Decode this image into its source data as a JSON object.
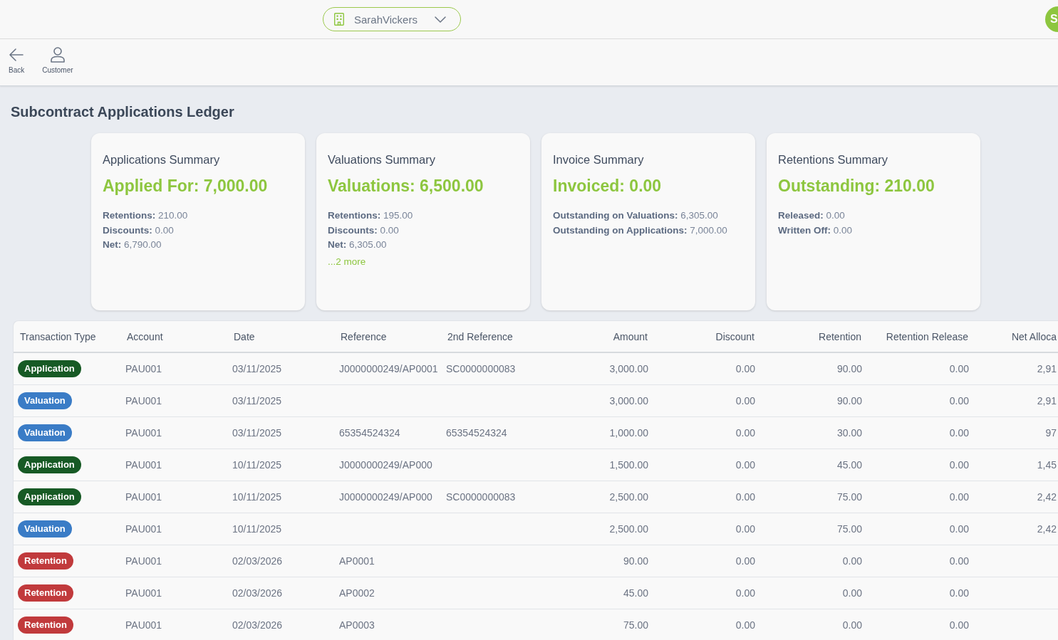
{
  "header": {
    "account_selector": {
      "value": "SarahVickers"
    },
    "avatar": {
      "initial": "S"
    }
  },
  "toolbar": {
    "buttons": [
      {
        "kind": "back",
        "label": "Back"
      },
      {
        "kind": "customer",
        "label": "Customer"
      }
    ]
  },
  "page_title": "Subcontract Applications Ledger",
  "summary_cards": [
    {
      "title": "Applications Summary",
      "headline": "Applied For: 7,000.00",
      "details": [
        "**Retentions:** 210.00",
        "**Discounts:** 0.00",
        "**Net:** 6,790.00"
      ]
    },
    {
      "title": "Valuations Summary",
      "headline": "Valuations: 6,500.00",
      "details": [
        "**Retentions:** 195.00",
        "**Discounts:** 0.00",
        "**Net:** 6,305.00"
      ],
      "more_link": "...2 more"
    },
    {
      "title": "Invoice Summary",
      "headline": "Invoiced: 0.00",
      "details": [
        "**Outstanding on Valuations:** 6,305.00",
        "**Outstanding on Applications:** 7,000.00"
      ]
    },
    {
      "title": "Retentions Summary",
      "headline": "Outstanding: 210.00",
      "details": [
        "**Released:** 0.00",
        "**Written Off:** 0.00"
      ]
    }
  ],
  "table": {
    "columns": [
      {
        "label": "Transaction Type",
        "kind": "badge"
      },
      {
        "label": "Account",
        "kind": "text"
      },
      {
        "label": "Date",
        "kind": "text"
      },
      {
        "label": "Reference",
        "kind": "text"
      },
      {
        "label": "2nd Reference",
        "kind": "text"
      },
      {
        "label": "Amount",
        "kind": "amount"
      },
      {
        "label": "Discount",
        "kind": "amount"
      },
      {
        "label": "Retention",
        "kind": "amount"
      },
      {
        "label": "Retention Release",
        "kind": "amount"
      },
      {
        "label": "Net Alloca",
        "kind": "amount"
      }
    ],
    "rows": [
      {
        "transaction_type": {
          "label": "Application",
          "color": "#175a25"
        },
        "account": "PAU001",
        "date": "03/11/2025",
        "reference": "J0000000249/AP0001",
        "second_reference": "SC0000000083",
        "amount": "3,000.00",
        "discount": "0.00",
        "retention": "90.00",
        "retention_release": "0.00",
        "column_10": "2,91"
      },
      {
        "transaction_type": {
          "label": "Valuation",
          "color": "#3a7cc6"
        },
        "account": "PAU001",
        "date": "03/11/2025",
        "amount": "3,000.00",
        "discount": "0.00",
        "retention": "90.00",
        "retention_release": "0.00",
        "column_10": "2,91"
      },
      {
        "transaction_type": {
          "label": "Valuation",
          "color": "#3a7cc6"
        },
        "account": "PAU001",
        "date": "03/11/2025",
        "reference": "65354524324",
        "second_reference": "65354524324",
        "amount": "1,000.00",
        "discount": "0.00",
        "retention": "30.00",
        "retention_release": "0.00",
        "column_10": "97"
      },
      {
        "transaction_type": {
          "label": "Application",
          "color": "#175a25"
        },
        "account": "PAU001",
        "date": "10/11/2025",
        "reference": "J0000000249/AP000",
        "amount": "1,500.00",
        "discount": "0.00",
        "retention": "45.00",
        "retention_release": "0.00",
        "column_10": "1,45"
      },
      {
        "transaction_type": {
          "label": "Application",
          "color": "#175a25"
        },
        "account": "PAU001",
        "date": "10/11/2025",
        "reference": "J0000000249/AP000",
        "second_reference": "SC0000000083",
        "amount": "2,500.00",
        "discount": "0.00",
        "retention": "75.00",
        "retention_release": "0.00",
        "column_10": "2,42"
      },
      {
        "transaction_type": {
          "label": "Valuation",
          "color": "#3a7cc6"
        },
        "account": "PAU001",
        "date": "10/11/2025",
        "amount": "2,500.00",
        "discount": "0.00",
        "retention": "75.00",
        "retention_release": "0.00",
        "column_10": "2,42"
      },
      {
        "transaction_type": {
          "label": "Retention",
          "color": "#c13a3c"
        },
        "account": "PAU001",
        "date": "02/03/2026",
        "reference": "AP0001",
        "amount": "90.00",
        "discount": "0.00",
        "retention": "0.00",
        "retention_release": "0.00"
      },
      {
        "transaction_type": {
          "label": "Retention",
          "color": "#c13a3c"
        },
        "account": "PAU001",
        "date": "02/03/2026",
        "reference": "AP0002",
        "amount": "45.00",
        "discount": "0.00",
        "retention": "0.00",
        "retention_release": "0.00"
      },
      {
        "transaction_type": {
          "label": "Retention",
          "color": "#c13a3c"
        },
        "account": "PAU001",
        "date": "02/03/2026",
        "reference": "AP0003",
        "amount": "75.00",
        "discount": "0.00",
        "retention": "0.00",
        "retention_release": "0.00"
      }
    ]
  }
}
